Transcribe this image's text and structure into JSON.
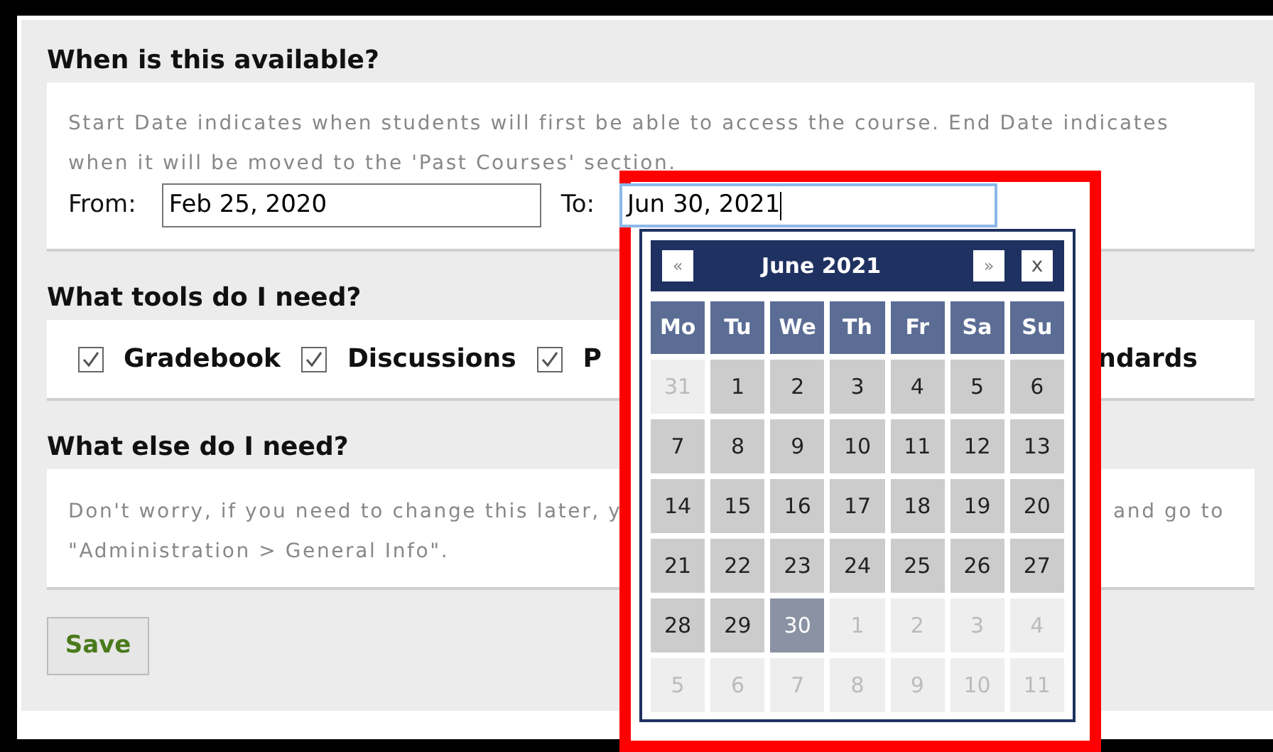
{
  "availability": {
    "heading": "When is this available?",
    "description": "Start Date indicates when students will first be able to access the course. End Date indicates when it will be moved to the 'Past Courses' section.",
    "from_label": "From:",
    "from_value": "Feb 25, 2020",
    "to_label": "To:",
    "to_value": "Jun 30, 2021"
  },
  "tools": {
    "heading": "What tools do I need?",
    "items": [
      {
        "label": "Gradebook",
        "checked": true
      },
      {
        "label": "Discussions",
        "checked": true
      },
      {
        "label": "P",
        "checked": true
      }
    ],
    "cut_label": "ndards"
  },
  "extras": {
    "heading": "What else do I need?",
    "note_left": "Don't worry, if you need to change this later, y",
    "note_right": "and go to",
    "note_line2": "\"Administration > General Info\"."
  },
  "save_button": "Save",
  "date_picker": {
    "prev": "«",
    "title": "June 2021",
    "next": "»",
    "close": "x",
    "weekdays": [
      "Mo",
      "Tu",
      "We",
      "Th",
      "Fr",
      "Sa",
      "Su"
    ],
    "days": [
      {
        "label": "31",
        "in_month": false,
        "selected": false
      },
      {
        "label": "1",
        "in_month": true,
        "selected": false
      },
      {
        "label": "2",
        "in_month": true,
        "selected": false
      },
      {
        "label": "3",
        "in_month": true,
        "selected": false
      },
      {
        "label": "4",
        "in_month": true,
        "selected": false
      },
      {
        "label": "5",
        "in_month": true,
        "selected": false
      },
      {
        "label": "6",
        "in_month": true,
        "selected": false
      },
      {
        "label": "7",
        "in_month": true,
        "selected": false
      },
      {
        "label": "8",
        "in_month": true,
        "selected": false
      },
      {
        "label": "9",
        "in_month": true,
        "selected": false
      },
      {
        "label": "10",
        "in_month": true,
        "selected": false
      },
      {
        "label": "11",
        "in_month": true,
        "selected": false
      },
      {
        "label": "12",
        "in_month": true,
        "selected": false
      },
      {
        "label": "13",
        "in_month": true,
        "selected": false
      },
      {
        "label": "14",
        "in_month": true,
        "selected": false
      },
      {
        "label": "15",
        "in_month": true,
        "selected": false
      },
      {
        "label": "16",
        "in_month": true,
        "selected": false
      },
      {
        "label": "17",
        "in_month": true,
        "selected": false
      },
      {
        "label": "18",
        "in_month": true,
        "selected": false
      },
      {
        "label": "19",
        "in_month": true,
        "selected": false
      },
      {
        "label": "20",
        "in_month": true,
        "selected": false
      },
      {
        "label": "21",
        "in_month": true,
        "selected": false
      },
      {
        "label": "22",
        "in_month": true,
        "selected": false
      },
      {
        "label": "23",
        "in_month": true,
        "selected": false
      },
      {
        "label": "24",
        "in_month": true,
        "selected": false
      },
      {
        "label": "25",
        "in_month": true,
        "selected": false
      },
      {
        "label": "26",
        "in_month": true,
        "selected": false
      },
      {
        "label": "27",
        "in_month": true,
        "selected": false
      },
      {
        "label": "28",
        "in_month": true,
        "selected": false
      },
      {
        "label": "29",
        "in_month": true,
        "selected": false
      },
      {
        "label": "30",
        "in_month": true,
        "selected": true
      },
      {
        "label": "1",
        "in_month": false,
        "selected": false
      },
      {
        "label": "2",
        "in_month": false,
        "selected": false
      },
      {
        "label": "3",
        "in_month": false,
        "selected": false
      },
      {
        "label": "4",
        "in_month": false,
        "selected": false
      },
      {
        "label": "5",
        "in_month": false,
        "selected": false
      },
      {
        "label": "6",
        "in_month": false,
        "selected": false
      },
      {
        "label": "7",
        "in_month": false,
        "selected": false
      },
      {
        "label": "8",
        "in_month": false,
        "selected": false
      },
      {
        "label": "9",
        "in_month": false,
        "selected": false
      },
      {
        "label": "10",
        "in_month": false,
        "selected": false
      },
      {
        "label": "11",
        "in_month": false,
        "selected": false
      }
    ]
  }
}
